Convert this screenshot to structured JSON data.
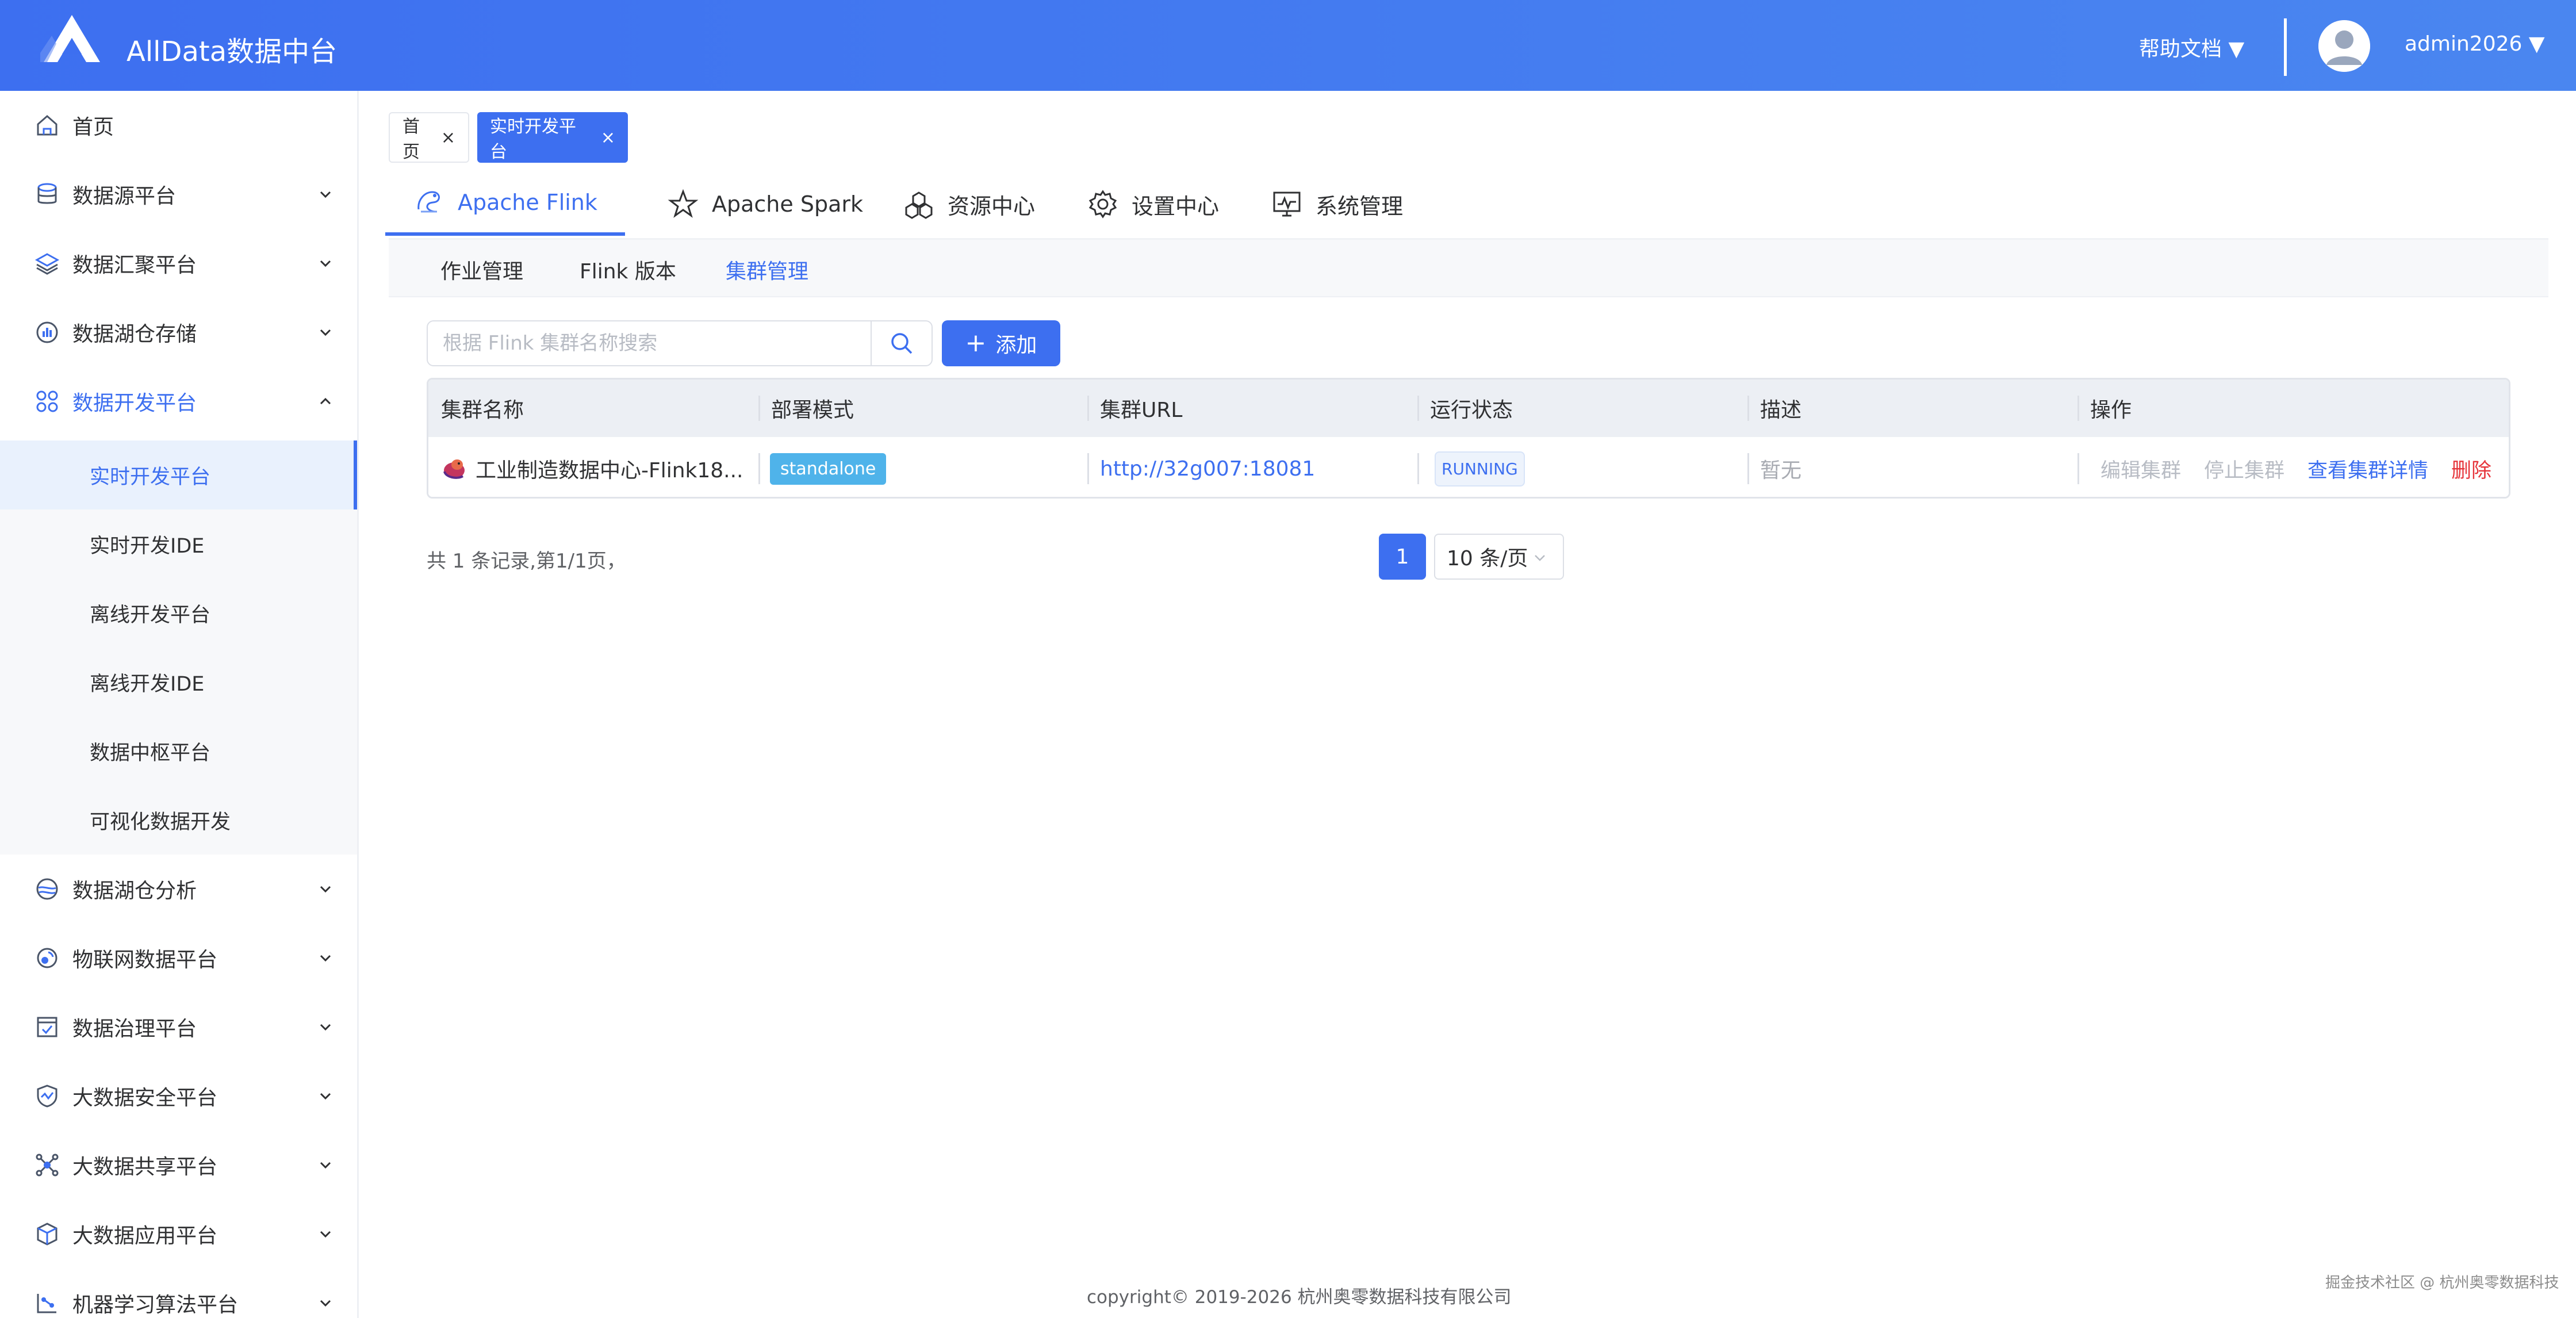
{
  "header": {
    "app_title": "AllData数据中台",
    "help_docs": "帮助文档 ▼",
    "user_name": "admin2026 ▼"
  },
  "sidebar": {
    "items": [
      {
        "label": "首页",
        "icon": "home-icon"
      },
      {
        "label": "数据源平台",
        "icon": "database-icon"
      },
      {
        "label": "数据汇聚平台",
        "icon": "layers-icon"
      },
      {
        "label": "数据湖仓存储",
        "icon": "chart-circle-icon"
      },
      {
        "label": "数据开发平台",
        "icon": "grid-icon"
      },
      {
        "label": "数据湖仓分析",
        "icon": "lake-icon"
      },
      {
        "label": "物联网数据平台",
        "icon": "iot-icon"
      },
      {
        "label": "数据治理平台",
        "icon": "checklist-icon"
      },
      {
        "label": "大数据安全平台",
        "icon": "shield-icon"
      },
      {
        "label": "大数据共享平台",
        "icon": "share-icon"
      },
      {
        "label": "大数据应用平台",
        "icon": "cube-icon"
      },
      {
        "label": "机器学习算法平台",
        "icon": "ml-icon"
      }
    ],
    "sub_items": [
      {
        "label": "实时开发平台"
      },
      {
        "label": "实时开发IDE"
      },
      {
        "label": "离线开发平台"
      },
      {
        "label": "离线开发IDE"
      },
      {
        "label": "数据中枢平台"
      },
      {
        "label": "可视化数据开发"
      }
    ]
  },
  "tags": {
    "home": "首页",
    "realtime": "实时开发平台",
    "close": "×"
  },
  "module_tabs": [
    {
      "label": "Apache Flink",
      "icon": "flink-icon"
    },
    {
      "label": "Apache Spark",
      "icon": "spark-star-icon"
    },
    {
      "label": "资源中心",
      "icon": "resource-icon"
    },
    {
      "label": "设置中心",
      "icon": "gear-icon"
    },
    {
      "label": "系统管理",
      "icon": "monitor-icon"
    }
  ],
  "sub_tabs": [
    "作业管理",
    "Flink 版本",
    "集群管理"
  ],
  "search": {
    "placeholder": "根据 Flink 集群名称搜索"
  },
  "add_button": {
    "plus": "+",
    "label": "添加"
  },
  "table": {
    "headers": [
      "集群名称",
      "部署模式",
      "集群URL",
      "运行状态",
      "描述",
      "操作"
    ],
    "row": {
      "name": "工业制造数据中心-Flink18...",
      "mode": "standalone",
      "url": "http://32g007:18081",
      "status": "RUNNING",
      "desc": "暂无",
      "ops": {
        "edit": "编辑集群",
        "stop": "停止集群",
        "detail": "查看集群详情",
        "delete": "删除"
      }
    }
  },
  "pagination": {
    "total_text": "共 1 条记录,第1/1页，",
    "current_page": "1",
    "page_size": "10 条/页"
  },
  "footer": {
    "copyright": "copyright© 2019-2026 杭州奥零数据科技有限公司",
    "watermark": "掘金技术社区 @ 杭州奥零数据科技"
  },
  "colors": {
    "primary": "#3d6ff0",
    "danger": "#e6353b",
    "badge_standalone": "#4fb3ea"
  }
}
